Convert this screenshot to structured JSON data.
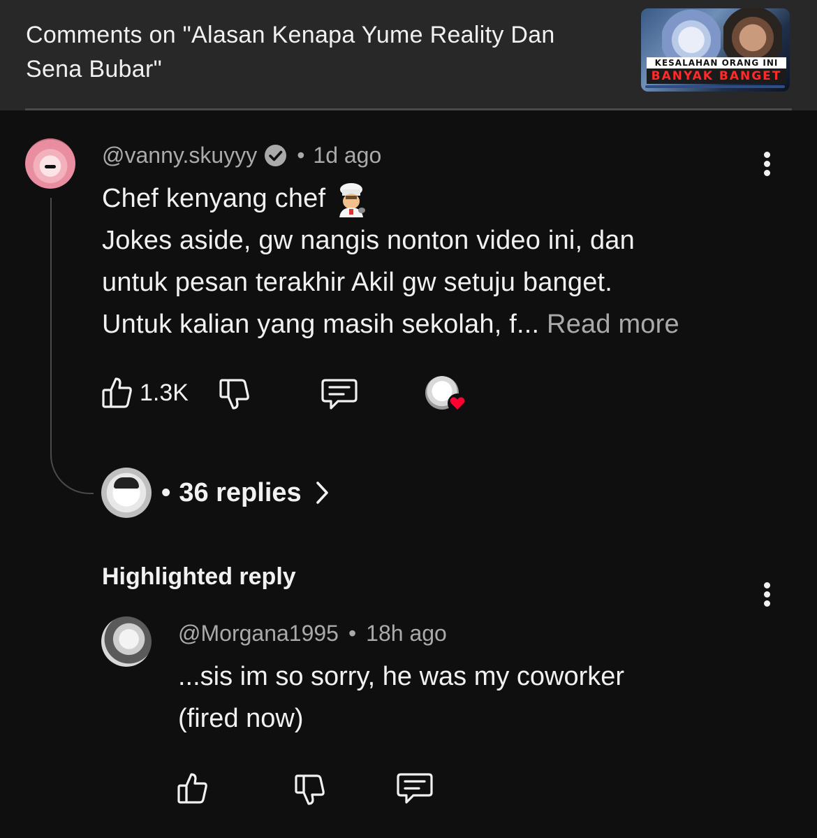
{
  "header": {
    "title": "Comments on \"Alasan Kenapa Yume Reality Dan Sena Bubar\"",
    "thumbnail": {
      "caption_top": "KESALAHAN ORANG INI",
      "caption_bottom": "BANYAK BANGET"
    }
  },
  "comment": {
    "author": "@vanny.skuyyy",
    "verified": true,
    "separator": "•",
    "time": "1d ago",
    "text_lines": [
      "Chef kenyang chef",
      "Jokes aside, gw nangis nonton video ini, dan",
      "untuk pesan terakhir Akil gw setuju banget.",
      "Untuk kalian yang masih sekolah, f..."
    ],
    "emoji": "chef-emoji",
    "read_more": "Read more",
    "likes": "1.3K",
    "creator_hearted": true,
    "replies": {
      "dot": "•",
      "label": "36 replies"
    }
  },
  "highlighted": {
    "title": "Highlighted reply",
    "author": "@Morgana1995",
    "separator": "•",
    "time": "18h ago",
    "text_lines": [
      "...sis im so sorry, he was my coworker",
      "(fired now)"
    ]
  },
  "colors": {
    "background": "#0f0f0f",
    "header_bg": "#282828",
    "text": "#f1f1f1",
    "secondary_text": "#aaaaaa",
    "heart": "#ff0033"
  }
}
